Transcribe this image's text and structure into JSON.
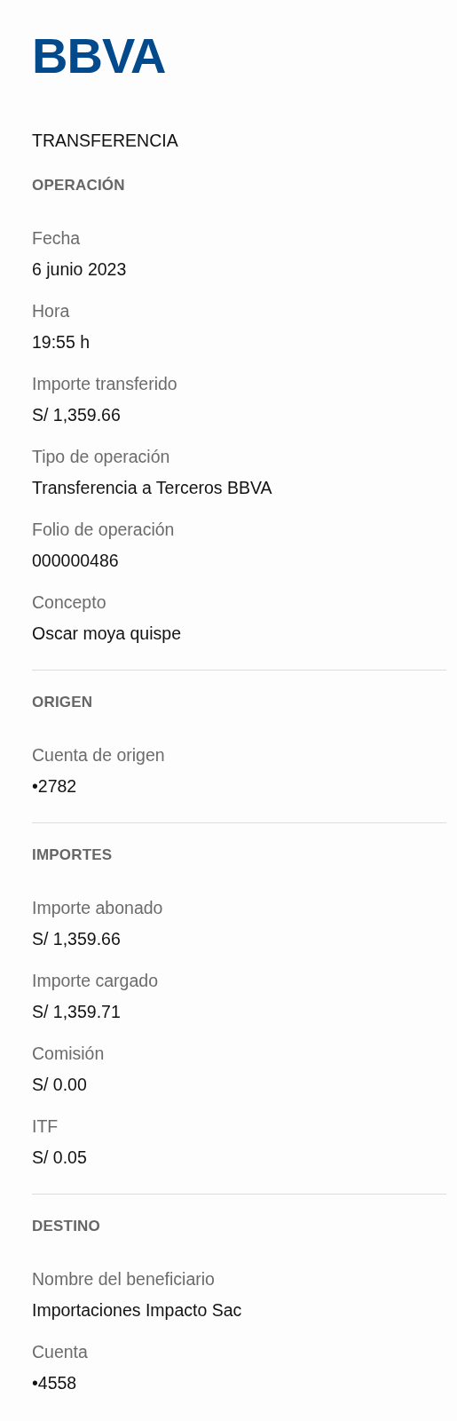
{
  "logo": "BBVA",
  "title": "TRANSFERENCIA",
  "sections": [
    {
      "heading": "OPERACIÓN",
      "fields": [
        {
          "label": "Fecha",
          "value": "6 junio 2023"
        },
        {
          "label": "Hora",
          "value": "19:55 h"
        },
        {
          "label": "Importe transferido",
          "value": "S/ 1,359.66"
        },
        {
          "label": "Tipo de operación",
          "value": "Transferencia a Terceros BBVA"
        },
        {
          "label": "Folio de operación",
          "value": "000000486"
        },
        {
          "label": "Concepto",
          "value": "Oscar moya quispe"
        }
      ]
    },
    {
      "heading": "ORIGEN",
      "fields": [
        {
          "label": "Cuenta de origen",
          "value": "•2782"
        }
      ]
    },
    {
      "heading": "IMPORTES",
      "fields": [
        {
          "label": "Importe abonado",
          "value": "S/ 1,359.66"
        },
        {
          "label": "Importe cargado",
          "value": "S/ 1,359.71"
        },
        {
          "label": "Comisión",
          "value": "S/ 0.00"
        },
        {
          "label": "ITF",
          "value": "S/ 0.05"
        }
      ]
    },
    {
      "heading": "DESTINO",
      "fields": [
        {
          "label": "Nombre del beneficiario",
          "value": "Importaciones Impacto Sac"
        },
        {
          "label": "Cuenta",
          "value": "•4558"
        }
      ]
    }
  ]
}
